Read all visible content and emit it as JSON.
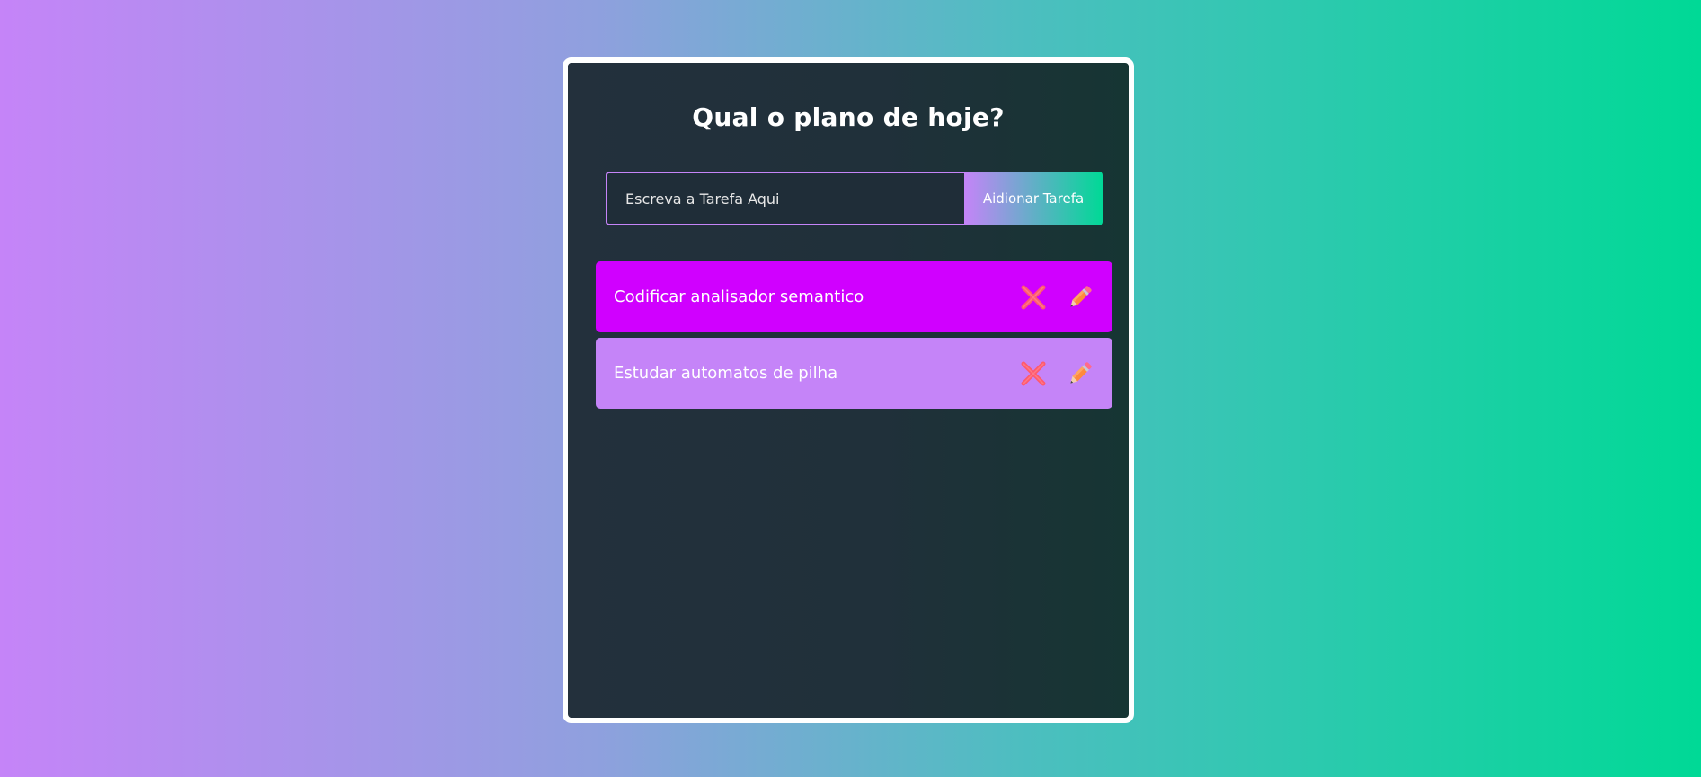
{
  "app": {
    "title": "Qual o plano de hoje?"
  },
  "form": {
    "placeholder": "Escreva a Tarefa Aqui",
    "value": "",
    "add_label": "Aidionar Tarefa"
  },
  "todos": [
    {
      "text": "Codificar analisador semantico",
      "color": "#d000ff",
      "delete_icon": "close-icon",
      "edit_icon": "pencil-icon"
    },
    {
      "text": "Estudar automatos de pilha",
      "color": "#c584f8",
      "delete_icon": "close-icon",
      "edit_icon": "pencil-icon"
    }
  ],
  "colors": {
    "background_start": "#c584f8",
    "background_end": "#00d996",
    "card": "#20303a",
    "delete_icon": "#ff5a6e",
    "edit_icon": "#ff8a3d"
  }
}
